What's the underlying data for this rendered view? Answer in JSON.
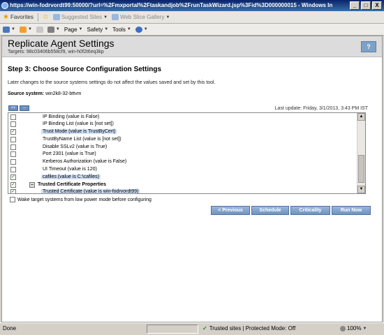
{
  "window": {
    "title": "https://win-fodrvordt99:50000/?url=%2Fmxportal%2Ftaskandjob%2FrunTaskWizard.jsp%3Fid%3D000000015 - Windows Inte...",
    "minimize": "_",
    "maximize": "□",
    "close": "X"
  },
  "favorites_bar": {
    "favorites": "Favorites",
    "suggested_sites": "Suggested Sites",
    "web_slice_gallery": "Web Slice Gallery"
  },
  "command_bar": {
    "page": "Page",
    "safety": "Safety",
    "tools": "Tools"
  },
  "header": {
    "title": "Replicate Agent Settings",
    "targets": "Targets: 98c03406b558cf9, win-h0f2t6eq3kp",
    "help": "?"
  },
  "step": {
    "title": "Step 3: Choose Source Configuration Settings",
    "note": "Later changes to the source systems settings do not affect the values saved and set by this tool.",
    "source_label": "Source system:",
    "source_value": "win2k8-32-bttvm"
  },
  "tree": {
    "expand_all": "++",
    "collapse_all": "--",
    "last_update": "Last update: Friday, 3/1/2013, 3:43 PM IST",
    "rows": [
      {
        "label": "IP Binding (value is False)",
        "checked": false,
        "selected": false
      },
      {
        "label": "IP Binding List (value is  [not set])",
        "checked": false,
        "selected": false
      },
      {
        "label": "Trust Mode (value is TrustByCert)",
        "checked": true,
        "selected": true
      },
      {
        "label": "TrustByName List (value is  [not set])",
        "checked": false,
        "selected": false
      },
      {
        "label": "Disable SSLv2 (value is True)",
        "checked": false,
        "selected": false
      },
      {
        "label": "Port 2301 (value is True)",
        "checked": false,
        "selected": false
      },
      {
        "label": "Kerberos Authorization (value is False)",
        "checked": false,
        "selected": false
      },
      {
        "label": "UI Timeout (value is 120)",
        "checked": false,
        "selected": false
      },
      {
        "label": "cafiles (value is C:\\cafiles)",
        "checked": true,
        "selected": true
      },
      {
        "label": "Trusted Certificate Properties",
        "checked": true,
        "selected": false,
        "group": true
      },
      {
        "label": "Trusted Certificate (value is  win-fodrvordt99)",
        "checked": true,
        "selected": true
      }
    ]
  },
  "wake_option": "Wake target systems from low power mode before configuring",
  "actions": {
    "previous": "< Previous",
    "schedule": "Schedule",
    "criticality": "Criticality",
    "run_now": "Run Now"
  },
  "statusbar": {
    "done": "Done",
    "zone": "Trusted sites | Protected Mode: Off",
    "zoom": "100%"
  },
  "colors": {
    "accent": "#6f93c1",
    "selection": "#cfe0f6",
    "titlebar": "#0a246a"
  }
}
